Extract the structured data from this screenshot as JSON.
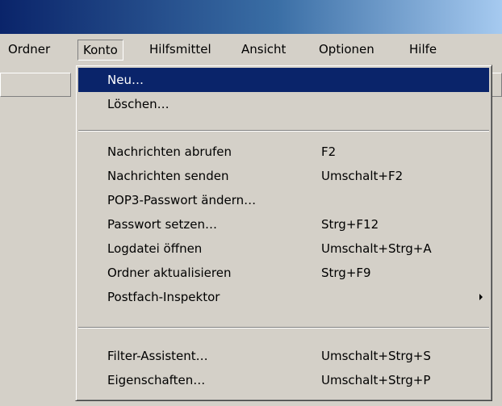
{
  "menubar": {
    "items": [
      "Ordner",
      "Konto",
      "Hilfsmittel",
      "Ansicht",
      "Optionen",
      "Hilfe"
    ],
    "open_item": "Konto"
  },
  "konto_menu": {
    "new": "Neu…",
    "delete": "Löschen…",
    "fetch_messages": {
      "label": "Nachrichten abrufen",
      "shortcut": "F2"
    },
    "send_messages": {
      "label": "Nachrichten senden",
      "shortcut": "Umschalt+F2"
    },
    "change_pop3_password": "POP3-Passwort ändern…",
    "set_password": {
      "label": "Passwort setzen…",
      "shortcut": "Strg+F12"
    },
    "open_logfile": {
      "label": "Logdatei öffnen",
      "shortcut": "Umschalt+Strg+A"
    },
    "refresh_folders": {
      "label": "Ordner aktualisieren",
      "shortcut": "Strg+F9"
    },
    "mailbox_inspector": "Postfach-Inspektor",
    "filter_wizard": {
      "label": "Filter-Assistent…",
      "shortcut": "Umschalt+Strg+S"
    },
    "properties": {
      "label": "Eigenschaften…",
      "shortcut": "Umschalt+Strg+P"
    }
  },
  "colors": {
    "selection": "#0a246a",
    "face": "#d4d0c8"
  }
}
